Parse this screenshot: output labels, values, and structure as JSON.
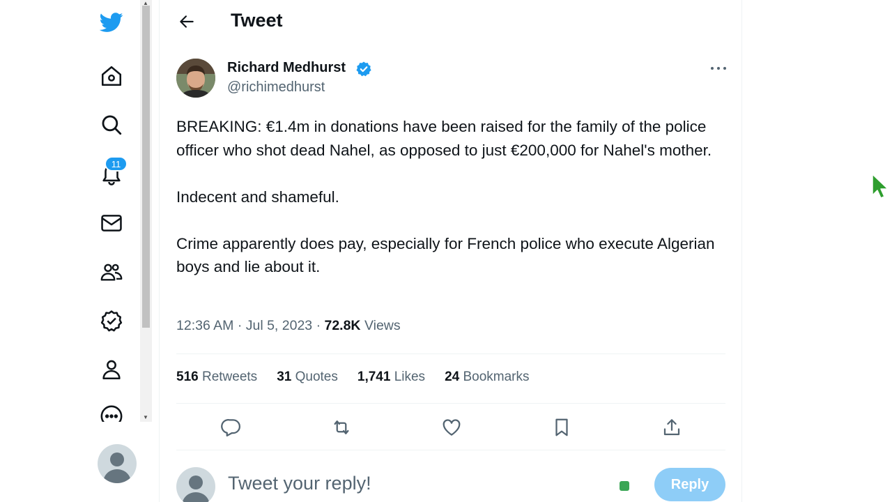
{
  "nav": {
    "notifications_badge": "11",
    "items": [
      "twitter-logo",
      "home",
      "explore",
      "notifications",
      "messages",
      "communities",
      "verified",
      "profile",
      "more"
    ]
  },
  "header": {
    "title": "Tweet"
  },
  "tweet": {
    "author_name": "Richard Medhurst",
    "handle": "@richimedhurst",
    "paragraphs": [
      "BREAKING: €1.4m in donations have been raised for the family of the police officer who shot dead Nahel, as opposed to just €200,000 for Nahel's mother.",
      "Indecent and shameful.",
      "Crime apparently does pay, especially for French police who execute Algerian boys and lie about it."
    ],
    "time": "12:36 AM",
    "date": "Jul 5, 2023",
    "views_count": "72.8K",
    "views_label": "Views"
  },
  "stats": {
    "retweets_count": "516",
    "retweets_label": "Retweets",
    "quotes_count": "31",
    "quotes_label": "Quotes",
    "likes_count": "1,741",
    "likes_label": "Likes",
    "bookmarks_count": "24",
    "bookmarks_label": "Bookmarks"
  },
  "reply": {
    "placeholder": "Tweet your reply!",
    "button_label": "Reply"
  },
  "colors": {
    "accent": "#1d9bf0",
    "reply_button": "#8ecdf7",
    "secondary_text": "#536471",
    "cursor": "#2e9e2e"
  }
}
